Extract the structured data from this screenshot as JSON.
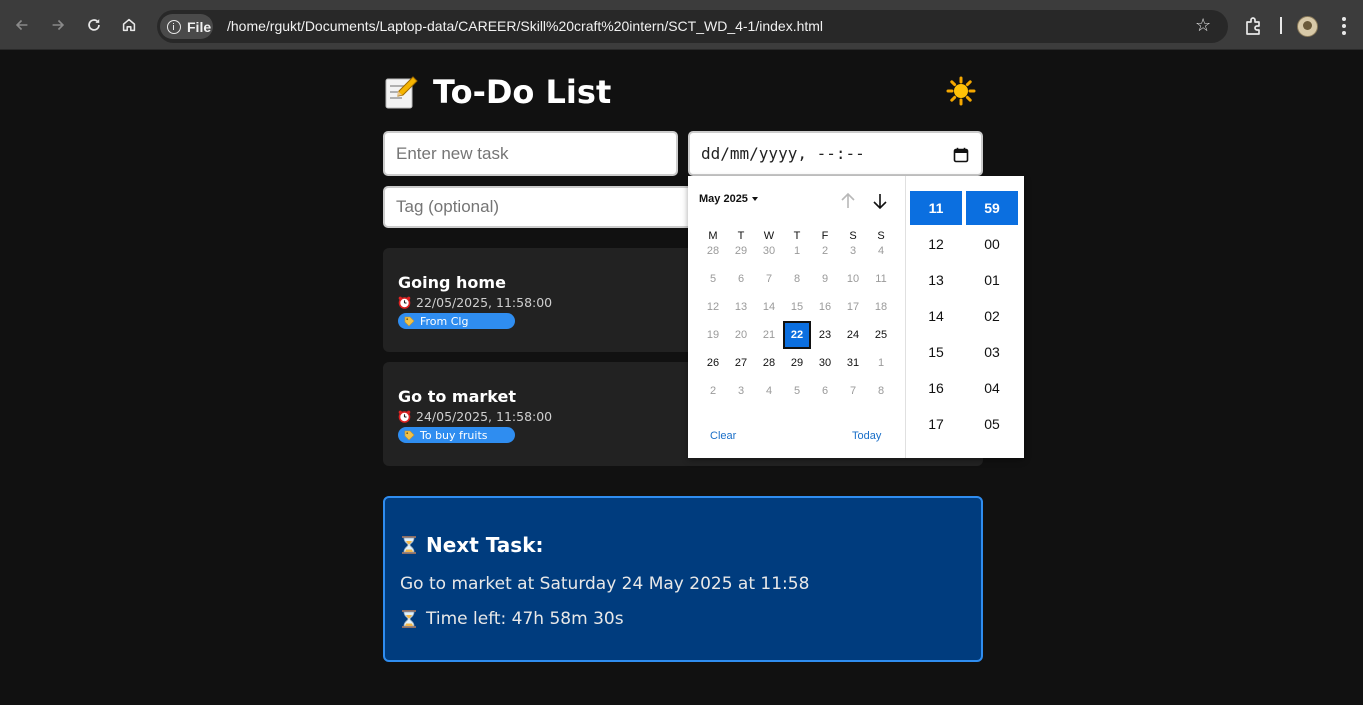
{
  "browser": {
    "file_label": "File",
    "url": "/home/rgukt/Documents/Laptop-data/CAREER/Skill%20craft%20intern/SCT_WD_4-1/index.html",
    "icons": [
      "back-icon",
      "forward-icon",
      "reload-icon",
      "home-icon",
      "info-icon",
      "star-icon",
      "extensions-icon",
      "profile-avatar",
      "menu-icon"
    ]
  },
  "app": {
    "title": "To-Do List",
    "title_icon": "memo-icon",
    "theme_icon": "sun-icon",
    "task_placeholder": "Enter new task",
    "date_placeholder": "dd/mm/yyyy, --:--",
    "tag_placeholder": "Tag (optional)",
    "tasks": [
      {
        "title": "Going home",
        "datetime": "22/05/2025, 11:58:00",
        "tag": "From Clg"
      },
      {
        "title": "Go to market",
        "datetime": "24/05/2025, 11:58:00",
        "tag": "To buy fruits"
      }
    ],
    "next_task": {
      "heading": "Next Task:",
      "line": "Go to market at Saturday 24 May 2025 at 11:58",
      "time_left": "Time left: 47h 58m 30s"
    }
  },
  "picker": {
    "month_label": "May 2025",
    "weekdays": [
      "M",
      "T",
      "W",
      "T",
      "F",
      "S",
      "S"
    ],
    "weeks": [
      [
        "28",
        "29",
        "30",
        "1",
        "2",
        "3",
        "4"
      ],
      [
        "5",
        "6",
        "7",
        "8",
        "9",
        "10",
        "11"
      ],
      [
        "12",
        "13",
        "14",
        "15",
        "16",
        "17",
        "18"
      ],
      [
        "19",
        "20",
        "21",
        "22",
        "23",
        "24",
        "25"
      ],
      [
        "26",
        "27",
        "28",
        "29",
        "30",
        "31",
        "1"
      ],
      [
        "2",
        "3",
        "4",
        "5",
        "6",
        "7",
        "8"
      ]
    ],
    "selected_day": "22",
    "clear_label": "Clear",
    "today_label": "Today",
    "hours": [
      "11",
      "12",
      "13",
      "14",
      "15",
      "16",
      "17"
    ],
    "minutes": [
      "59",
      "00",
      "01",
      "02",
      "03",
      "04",
      "05"
    ],
    "selected_hour": "11",
    "selected_minute": "59",
    "accent_color": "#0b6fe0"
  },
  "colors": {
    "background": "#111111",
    "card": "#222222",
    "tag": "#2f8df0",
    "next_box": "#003c7e",
    "next_border": "#2f8df0"
  }
}
